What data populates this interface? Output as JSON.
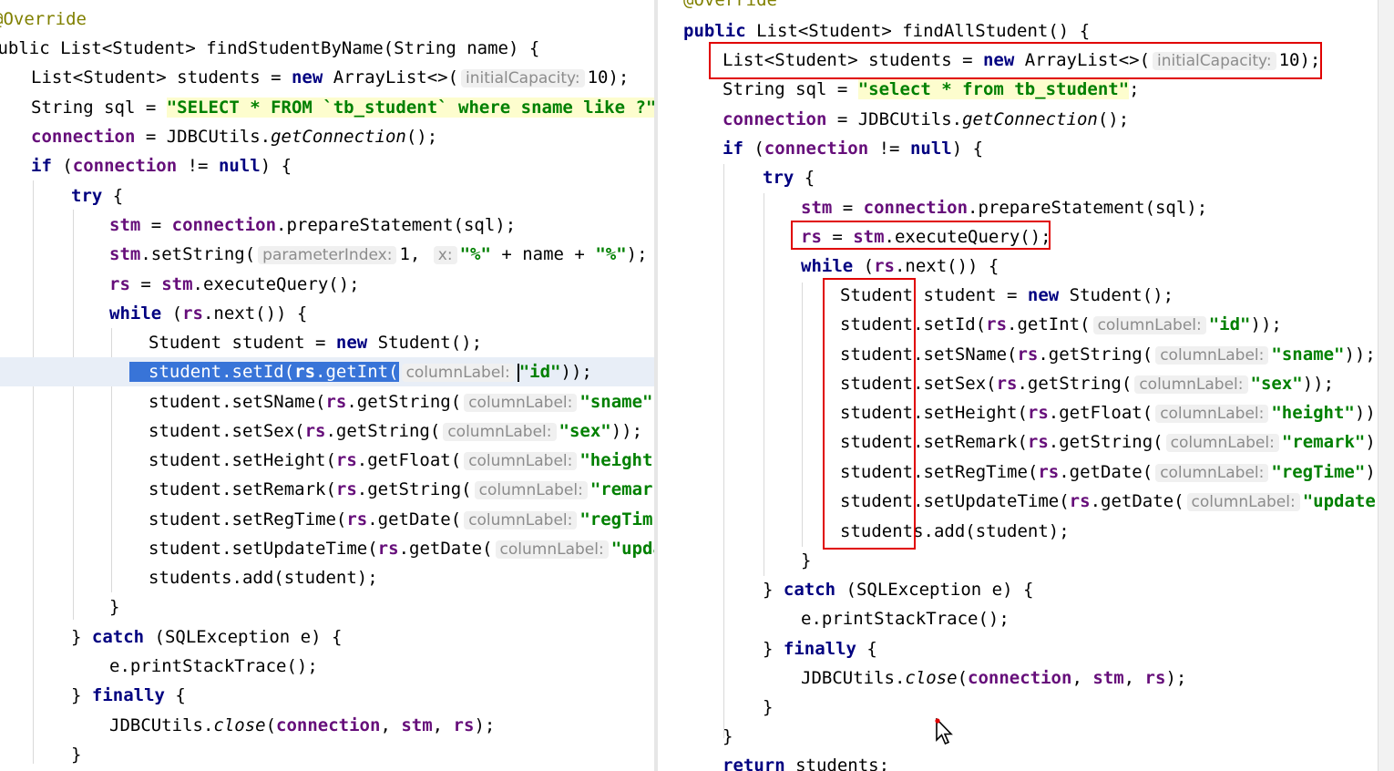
{
  "left": {
    "annotation": "@Override",
    "signature": "public List<Student> findStudentByName(String name) {",
    "list_decl": {
      "type": "List<Student> students = ",
      "new": "new",
      "ctor": " ArrayList<>(",
      "hint": "initialCapacity:",
      "val": "10);"
    },
    "sql_decl": {
      "prefix": "String sql = ",
      "string": "\"SELECT * FROM `tb_student` where sname like ?\"",
      "suffix": ";"
    },
    "conn": {
      "field": "connection",
      "mid": " = JDBCUtils.",
      "method": "getConnection",
      "end": "();"
    },
    "if_line": {
      "kw": "if",
      "open": " (",
      "field": "connection",
      "mid": " != ",
      "null": "null",
      "end": ") {"
    },
    "try_kw": "try",
    "brace_open": " {",
    "stm_prep": {
      "f1": "stm",
      "eq": " = ",
      "f2": "connection",
      "rest": ".prepareStatement(sql);"
    },
    "set_string": {
      "f": "stm",
      "call": ".setString(",
      "hint1": "parameterIndex:",
      "v1": "1,",
      "hint2": "x:",
      "s1": "\"%\"",
      "mid": " + name + ",
      "s2": "\"%\"",
      "end": ");"
    },
    "rs_exec": {
      "f1": "rs",
      "eq": " = ",
      "f2": "stm",
      "rest": ".executeQuery();"
    },
    "while_line": {
      "kw": "while",
      "open": " (",
      "f": "rs",
      "rest": ".next()) {"
    },
    "student_new": {
      "pre": "Student student = ",
      "kw": "new",
      "post": " Student();"
    },
    "set_id": {
      "pre": "student.setId(",
      "f": "rs",
      "call": ".getInt(",
      "hint": "columnLabel:",
      "s": "\"id\"",
      "end": "));"
    },
    "set_sname": {
      "pre": "student.setSName(",
      "f": "rs",
      "call": ".getString(",
      "hint": "columnLabel:",
      "s": "\"sname\""
    },
    "set_sex": {
      "pre": "student.setSex(",
      "f": "rs",
      "call": ".getString(",
      "hint": "columnLabel:",
      "s": "\"sex\"",
      "end": "));"
    },
    "set_height": {
      "pre": "student.setHeight(",
      "f": "rs",
      "call": ".getFloat(",
      "hint": "columnLabel:",
      "s": "\"height"
    },
    "set_remark": {
      "pre": "student.setRemark(",
      "f": "rs",
      "call": ".getString(",
      "hint": "columnLabel:",
      "s": "\"remar"
    },
    "set_regtime": {
      "pre": "student.setRegTime(",
      "f": "rs",
      "call": ".getDate(",
      "hint": "columnLabel:",
      "s": "\"regTim"
    },
    "set_updatetime": {
      "pre": "student.setUpdateTime(",
      "f": "rs",
      "call": ".getDate(",
      "hint": "columnLabel:",
      "s": "\"upda"
    },
    "add_line": "students.add(student);",
    "close_brace": "}",
    "catch_line": {
      "open": "} ",
      "kw": "catch",
      "rest": " (SQLException e) {"
    },
    "print_trace": "e.printStackTrace();",
    "finally_line": {
      "open": "} ",
      "kw": "finally",
      "rest": " {"
    },
    "close_line": {
      "pre": "JDBCUtils.",
      "method": "close",
      "open": "(",
      "f1": "connection",
      "c1": ", ",
      "f2": "stm",
      "c2": ", ",
      "f3": "rs",
      "end": ");"
    }
  },
  "right": {
    "annotation": "@Override",
    "signature": {
      "kw": "public",
      "rest": " List<Student> findAllStudent() {"
    },
    "list_decl": {
      "type": "List<Student> students = ",
      "new": "new",
      "ctor": " ArrayList<>(",
      "hint": "initialCapacity:",
      "val": "10);"
    },
    "sql_decl": {
      "prefix": "String sql = ",
      "string": "\"select * from tb_student\"",
      "suffix": ";"
    },
    "conn": {
      "field": "connection",
      "mid": " = JDBCUtils.",
      "method": "getConnection",
      "end": "();"
    },
    "if_line": {
      "kw": "if",
      "open": " (",
      "field": "connection",
      "mid": " != ",
      "null": "null",
      "end": ") {"
    },
    "try_kw": "try",
    "brace_open": " {",
    "stm_prep": {
      "f1": "stm",
      "eq": " = ",
      "f2": "connection",
      "rest": ".prepareStatement(sql);"
    },
    "rs_exec": {
      "f1": "rs",
      "eq": " = ",
      "f2": "stm",
      "rest": ".executeQuery();"
    },
    "while_line": {
      "kw": "while",
      "open": " (",
      "f": "rs",
      "rest": ".next()) {"
    },
    "student_new": {
      "pre": "Student student = ",
      "kw": "new",
      "post": " Student();"
    },
    "set_id": {
      "pre": "student.setId(",
      "f": "rs",
      "call": ".getInt(",
      "hint": "columnLabel:",
      "s": "\"id\"",
      "end": "));"
    },
    "set_sname": {
      "pre": "student.setSName(",
      "f": "rs",
      "call": ".getString(",
      "hint": "columnLabel:",
      "s": "\"sname\"",
      "end": "));"
    },
    "set_sex": {
      "pre": "student.setSex(",
      "f": "rs",
      "call": ".getString(",
      "hint": "columnLabel:",
      "s": "\"sex\"",
      "end": "));"
    },
    "set_height": {
      "pre": "student.setHeight(",
      "f": "rs",
      "call": ".getFloat(",
      "hint": "columnLabel:",
      "s": "\"height\"",
      "end": "))"
    },
    "set_remark": {
      "pre": "student.setRemark(",
      "f": "rs",
      "call": ".getString(",
      "hint": "columnLabel:",
      "s": "\"remark\"",
      "end": ")"
    },
    "set_regtime": {
      "pre": "student.setRegTime(",
      "f": "rs",
      "call": ".getDate(",
      "hint": "columnLabel:",
      "s": "\"regTime\"",
      "end": ")"
    },
    "set_updatetime": {
      "pre": "student.setUpdateTime(",
      "f": "rs",
      "call": ".getDate(",
      "hint": "columnLabel:",
      "s": "\"update"
    },
    "add_line": "students.add(student);",
    "close_brace": "}",
    "catch_line": {
      "open": "} ",
      "kw": "catch",
      "rest": " (SQLException e) {"
    },
    "print_trace": "e.printStackTrace();",
    "finally_line": {
      "open": "} ",
      "kw": "finally",
      "rest": " {"
    },
    "close_line": {
      "pre": "JDBCUtils.",
      "method": "close",
      "open": "(",
      "f1": "connection",
      "c1": ", ",
      "f2": "stm",
      "c2": ", ",
      "f3": "rs",
      "end": ");"
    },
    "return_line": {
      "kw": "return",
      "rest": " students;"
    }
  },
  "colors": {
    "keyword": "#000080",
    "field": "#660e7a",
    "string": "#008000",
    "annotation": "#808000",
    "highlight_box": "#e00000",
    "selection": "#3874d8"
  },
  "icons": {
    "cursor": "mouse-pointer-icon"
  }
}
